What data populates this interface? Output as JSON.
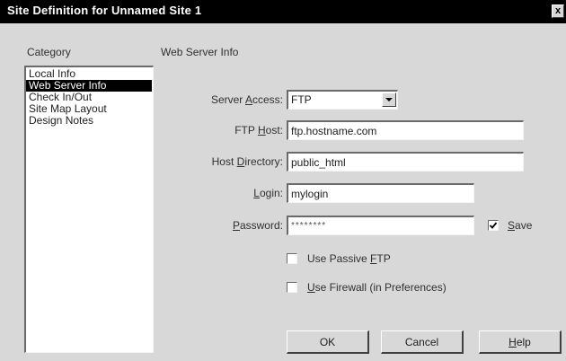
{
  "window": {
    "title": "Site Definition for Unnamed Site 1",
    "close_glyph": "x"
  },
  "category": {
    "label": "Category",
    "items": [
      {
        "label": "Local Info",
        "selected": false
      },
      {
        "label": "Web Server Info",
        "selected": true
      },
      {
        "label": "Check In/Out",
        "selected": false
      },
      {
        "label": "Site Map Layout",
        "selected": false
      },
      {
        "label": "Design Notes",
        "selected": false
      }
    ]
  },
  "section": {
    "title": "Web Server Info"
  },
  "form": {
    "server_access": {
      "label_pre": "Server ",
      "label_key": "A",
      "label_post": "ccess:",
      "value": "FTP"
    },
    "ftp_host": {
      "label_pre": "FTP ",
      "label_key": "H",
      "label_post": "ost:",
      "value": "ftp.hostname.com"
    },
    "host_directory": {
      "label_pre": "Host ",
      "label_key": "D",
      "label_post": "irectory:",
      "value": "public_html"
    },
    "login": {
      "label_pre": "",
      "label_key": "L",
      "label_post": "ogin:",
      "value": "mylogin"
    },
    "password": {
      "label_pre": "",
      "label_key": "P",
      "label_post": "assword:",
      "value": "********"
    },
    "save": {
      "label_pre": "",
      "label_key": "S",
      "label_post": "ave",
      "checked": true
    },
    "passive_ftp": {
      "label_pre": "Use Passive ",
      "label_key": "F",
      "label_post": "TP",
      "checked": false
    },
    "firewall": {
      "label_pre": "",
      "label_key": "U",
      "label_post": "se Firewall (in Preferences)",
      "checked": false
    }
  },
  "buttons": {
    "ok": "OK",
    "cancel": "Cancel",
    "help_key": "H",
    "help_post": "elp"
  }
}
